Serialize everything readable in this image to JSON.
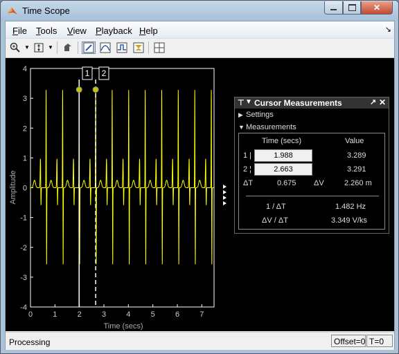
{
  "window": {
    "title": "Time Scope"
  },
  "menu": [
    {
      "label": "File",
      "key": "F",
      "rest": "ile"
    },
    {
      "label": "Tools",
      "key": "T",
      "rest": "ools"
    },
    {
      "label": "View",
      "key": "V",
      "rest": "iew"
    },
    {
      "label": "Playback",
      "key": "P",
      "rest": "layback"
    },
    {
      "label": "Help",
      "key": "H",
      "rest": "elp"
    }
  ],
  "toolbar": {
    "icons": [
      "zoom-in-icon",
      "zoom-dropdown-icon",
      "scale-axes-icon",
      "scale-dropdown-icon",
      "highlight-simulink-icon",
      "cursor-measurements-icon",
      "signal-statistics-icon",
      "bilevel-measurements-icon",
      "peak-finder-icon",
      "layout-icon"
    ],
    "active": "cursor-measurements-icon"
  },
  "plot": {
    "ylabel": "Amplitude",
    "xlabel": "Time (secs)",
    "yticks": [
      "4",
      "3",
      "2",
      "1",
      "0",
      "-1",
      "-2",
      "-3",
      "-4"
    ],
    "xticks": [
      "0",
      "1",
      "2",
      "3",
      "4",
      "5",
      "6",
      "7"
    ],
    "cursor1_label": "1",
    "cursor2_label": "2",
    "trace_color": "#ffff00",
    "background": "#000000"
  },
  "chart_data": {
    "type": "line",
    "title": "",
    "xlabel": "Time (secs)",
    "ylabel": "Amplitude",
    "xlim": [
      0,
      7.5
    ],
    "ylim": [
      -4,
      4
    ],
    "grid": false,
    "series": [
      {
        "color": "#ffff00",
        "description": "periodic ECG-like pulse train, R peaks ~3.3, period ~0.675 s, small ~1.0 intermediate peaks, troughs to ~-2.5"
      }
    ],
    "cursors": [
      {
        "label": "1",
        "time": 1.988,
        "value": 3.289
      },
      {
        "label": "2",
        "time": 2.663,
        "value": 3.291
      }
    ]
  },
  "panel": {
    "title": "Cursor Measurements",
    "settings_label": "Settings",
    "measurements_label": "Measurements",
    "col_time": "Time (secs)",
    "col_value": "Value",
    "row1_label": "1",
    "row1_time": "1.988",
    "row1_value": "3.289",
    "row2_label": "2",
    "row2_time": "2.663",
    "row2_value": "3.291",
    "dt_label": "ΔT",
    "dt_value": "0.675",
    "dv_label": "ΔV",
    "dv_value": "2.260 m",
    "inv_dt_label": "1 / ΔT",
    "inv_dt_value": "1.482 Hz",
    "dvdt_label": "ΔV / ΔT",
    "dvdt_value": "3.349 V/ks"
  },
  "status": {
    "text": "Processing",
    "offset": "Offset=0",
    "time": "T=0"
  }
}
